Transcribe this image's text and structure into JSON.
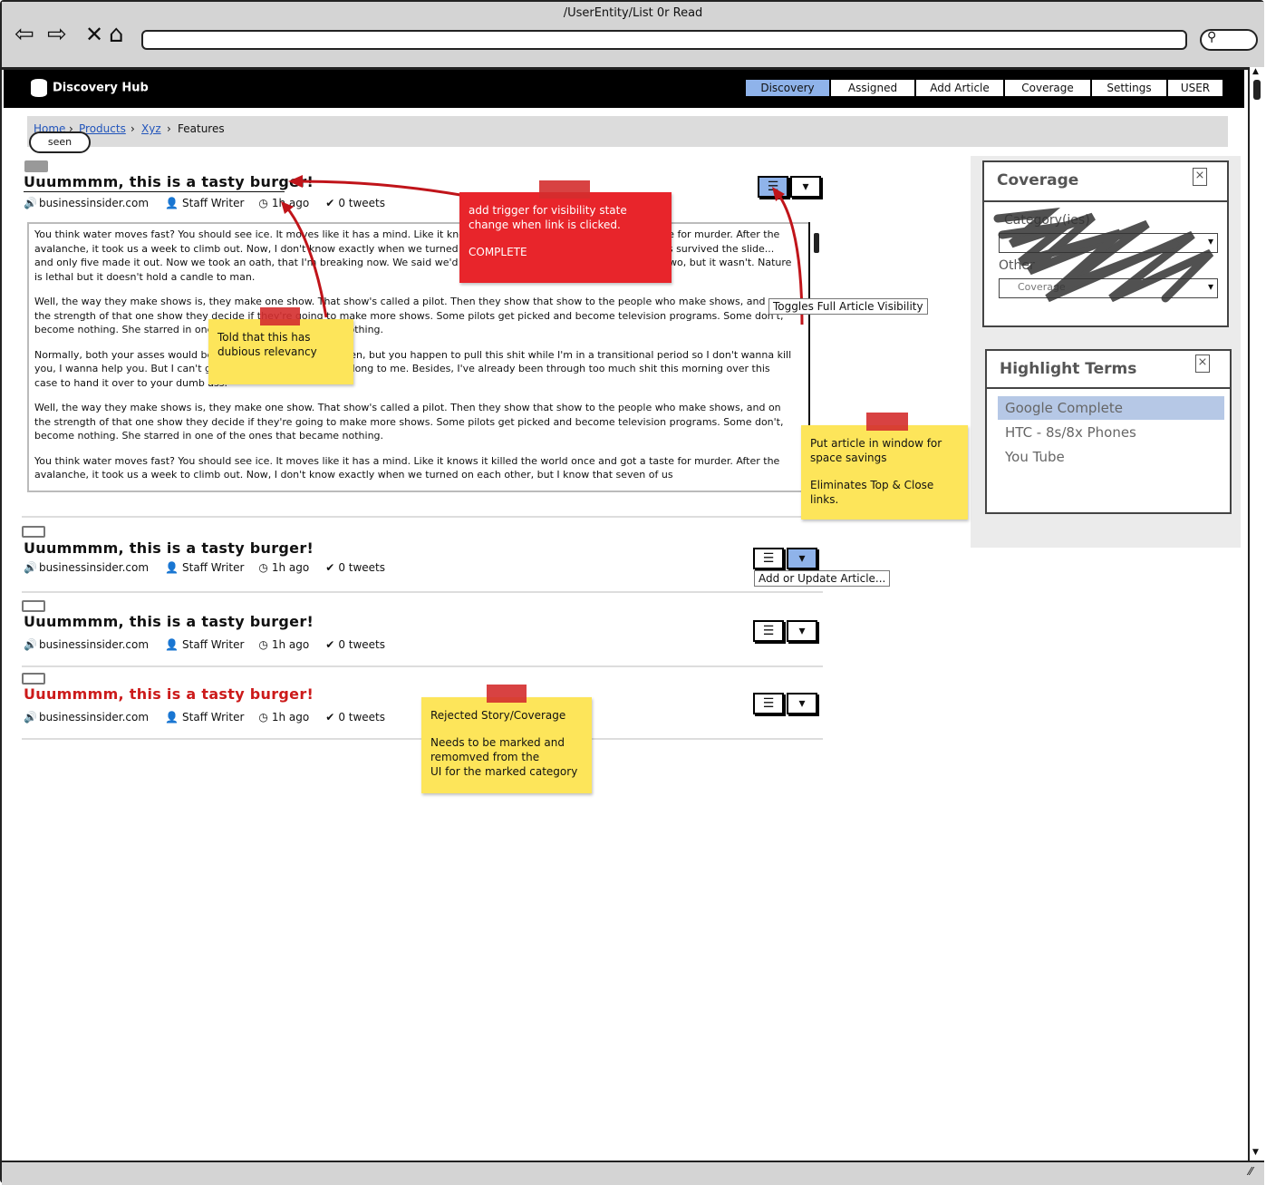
{
  "browser": {
    "url_title": "/UserEntity/List 0r Read"
  },
  "app": {
    "name": "Discovery Hub",
    "tabs": [
      "Discovery",
      "Assigned",
      "Add Article",
      "Coverage",
      "Settings",
      "USER"
    ],
    "active_tab": "Discovery"
  },
  "breadcrumb": {
    "items": [
      "Home",
      "Products",
      "Xyz",
      "Features"
    ],
    "separator": "›"
  },
  "seen_label": "seen",
  "articles": [
    {
      "title": "Uuummmm, this is a tasty burger!",
      "source": "businessinsider.com",
      "author": "Staff Writer",
      "time": "1h ago",
      "tweets": "0 tweets",
      "status": "seen",
      "body": [
        "You think water moves fast? You should see ice. It moves like it has a mind. Like it knows it killed the world once and got a taste for murder. After the avalanche, it took us a week to climb out. Now, I don't know exactly when we turned on each other, but I know that seven of us survived the slide... and only five made it out. Now we took an oath, that I'm breaking now. We said we'd say it was the snow that killed the other two, but it wasn't. Nature is lethal but it doesn't hold a candle to man.",
        "Well, the way they make shows is, they make one show. That show's called a pilot. Then they show that show to the people who make shows, and on the strength of that one show they decide if they're going to make more shows. Some pilots get picked and become television programs. Some don't, become nothing. She starred in one of the ones that became nothing.",
        "Normally, both your asses would be dead as fucking fried chicken, but you happen to pull this shit while I'm in a transitional period so I don't wanna kill you, I wanna help you. But I can't give you this case, it don't belong to me. Besides, I've already been through too much shit this morning over this case to hand it over to your dumb ass.",
        "Well, the way they make shows is, they make one show. That show's called a pilot. Then they show that show to the people who make shows, and on the strength of that one show they decide if they're going to make more shows. Some pilots get picked and become television programs. Some don't, become nothing. She starred in one of the ones that became nothing.",
        "You think water moves fast? You should see ice. It moves like it has a mind. Like it knows it killed the world once and got a taste for murder. After the avalanche, it took us a week to climb out. Now, I don't know exactly when we turned on each other, but I know that seven of us"
      ]
    },
    {
      "title": "Uuummmm, this is a tasty burger!",
      "source": "businessinsider.com",
      "author": "Staff Writer",
      "time": "1h ago",
      "tweets": "0 tweets",
      "status": "unseen"
    },
    {
      "title": "Uuummmm, this is a tasty burger!",
      "source": "businessinsider.com",
      "author": "Staff Writer",
      "time": "1h ago",
      "tweets": "0 tweets",
      "status": "unseen"
    },
    {
      "title": "Uuummmm, this is a tasty burger!",
      "source": "businessinsider.com",
      "author": "Staff Writer",
      "time": "1h ago",
      "tweets": "0 tweets",
      "status": "rejected"
    }
  ],
  "tooltips": {
    "toggle_visibility": "Toggles Full Article Visibility",
    "add_update": "Add or Update Article..."
  },
  "coverage_panel": {
    "title": "Coverage",
    "category_label": "Category(ies)",
    "other_label": "Other",
    "coverage_placeholder": "Coverage"
  },
  "highlight_panel": {
    "title": "Highlight Terms",
    "items": [
      "Google Complete",
      "HTC - 8s/8x Phones",
      "You Tube"
    ],
    "selected": "Google Complete"
  },
  "notes": {
    "red_note": [
      "add trigger for visibility state",
      "change when link is clicked.",
      "",
      "COMPLETE"
    ],
    "relevancy_note": [
      "Told that this has",
      "dubious relevancy"
    ],
    "space_note": [
      "Put article in window for",
      "space savings",
      "",
      "Eliminates Top & Close links."
    ],
    "rejected_note": [
      "Rejected Story/Coverage",
      "",
      "Needs to be marked and",
      "remomved from the",
      "UI for the marked category"
    ]
  },
  "colors": {
    "accent_tab": "#8fb3ea",
    "rejected_title": "#cc1a1a",
    "sticky_yellow": "#fde55a",
    "sticky_red": "#e8252b",
    "arrow_red": "#c0141a"
  },
  "icons": {
    "back": "back-arrow-icon",
    "forward": "forward-arrow-icon",
    "stop": "close-icon",
    "home": "home-icon",
    "search": "search-icon",
    "db": "database-icon",
    "speaker": "speaker-icon",
    "user": "user-icon",
    "clock": "clock-icon",
    "twitter": "twitter-icon",
    "menu": "menu-icon",
    "dropdown": "chevron-down-icon"
  }
}
